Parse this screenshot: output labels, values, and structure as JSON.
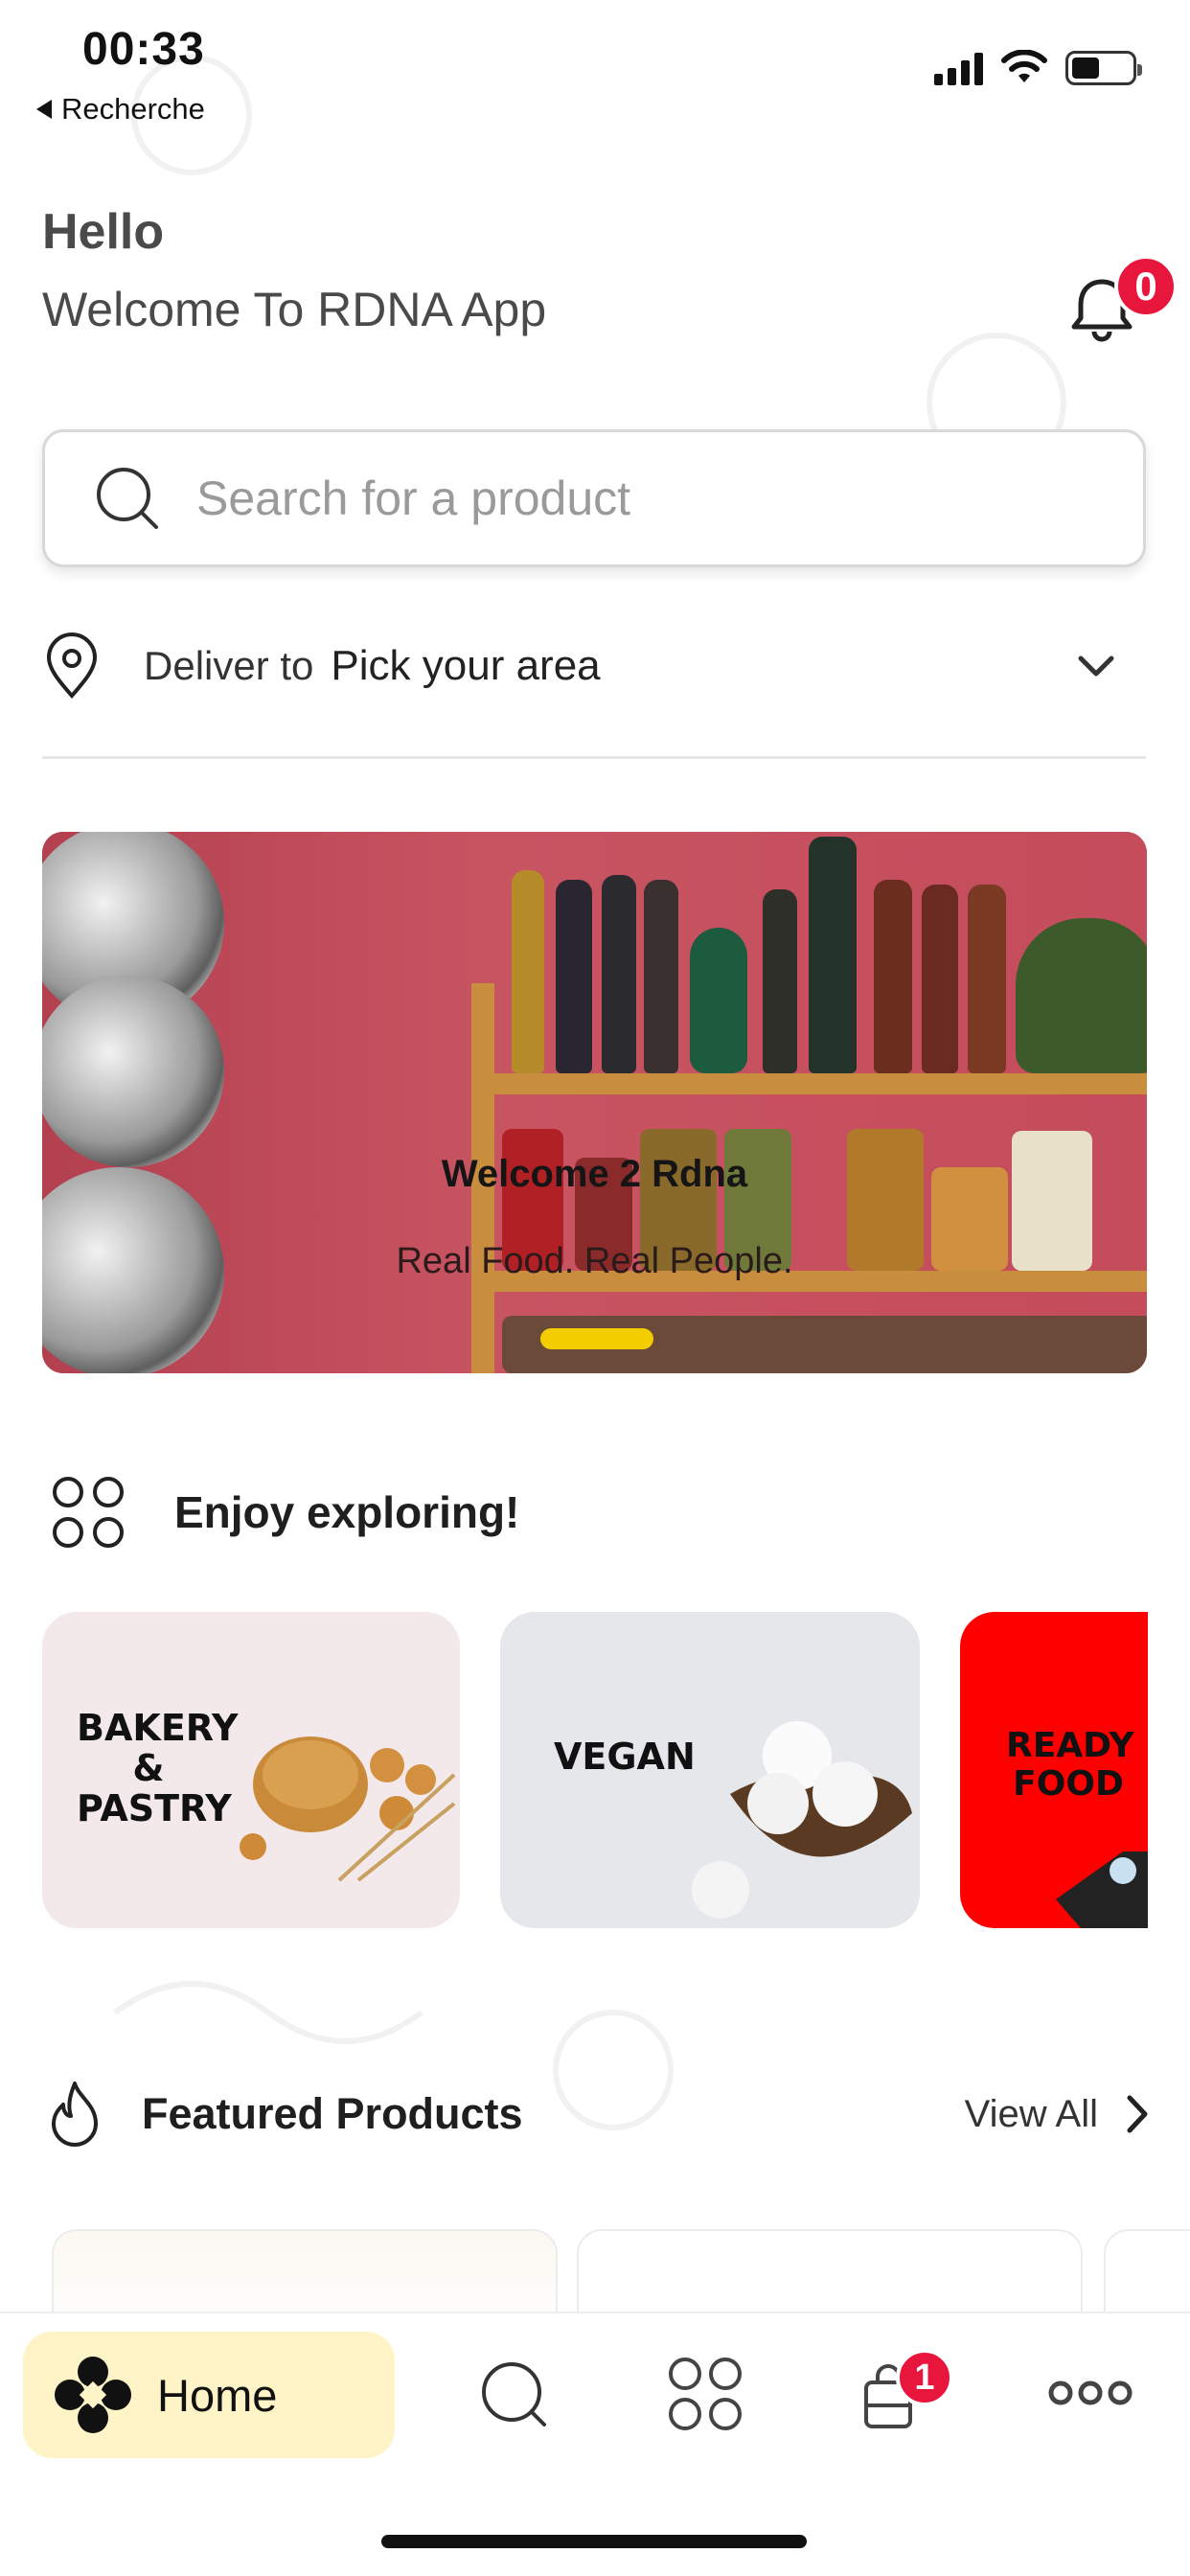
{
  "status_bar": {
    "time": "00:33",
    "back_label": "Recherche"
  },
  "header": {
    "hello": "Hello",
    "welcome": "Welcome To RDNA App",
    "notifications_count": "0"
  },
  "search": {
    "placeholder": "Search for a product"
  },
  "delivery": {
    "label": "Deliver to",
    "area": "Pick your area"
  },
  "banner": {
    "title": "Welcome 2 Rdna",
    "subtitle": "Real Food. Real People."
  },
  "categories": {
    "heading": "Enjoy exploring!",
    "items": [
      {
        "label_lines": [
          "BAKERY",
          "&",
          "PASTRY"
        ]
      },
      {
        "label_lines": [
          "VEGAN"
        ]
      },
      {
        "label_lines": [
          "READY",
          "FOOD"
        ]
      }
    ]
  },
  "featured": {
    "heading": "Featured Products",
    "view_all": "View All"
  },
  "tabbar": {
    "home_label": "Home",
    "cart_count": "1"
  },
  "colors": {
    "accent_yellow": "#f3cd00",
    "home_pill": "#fff4c7",
    "badge_red": "#e8163c",
    "banner_wall": "#c24a58",
    "ready_food_red": "#ff0000"
  }
}
